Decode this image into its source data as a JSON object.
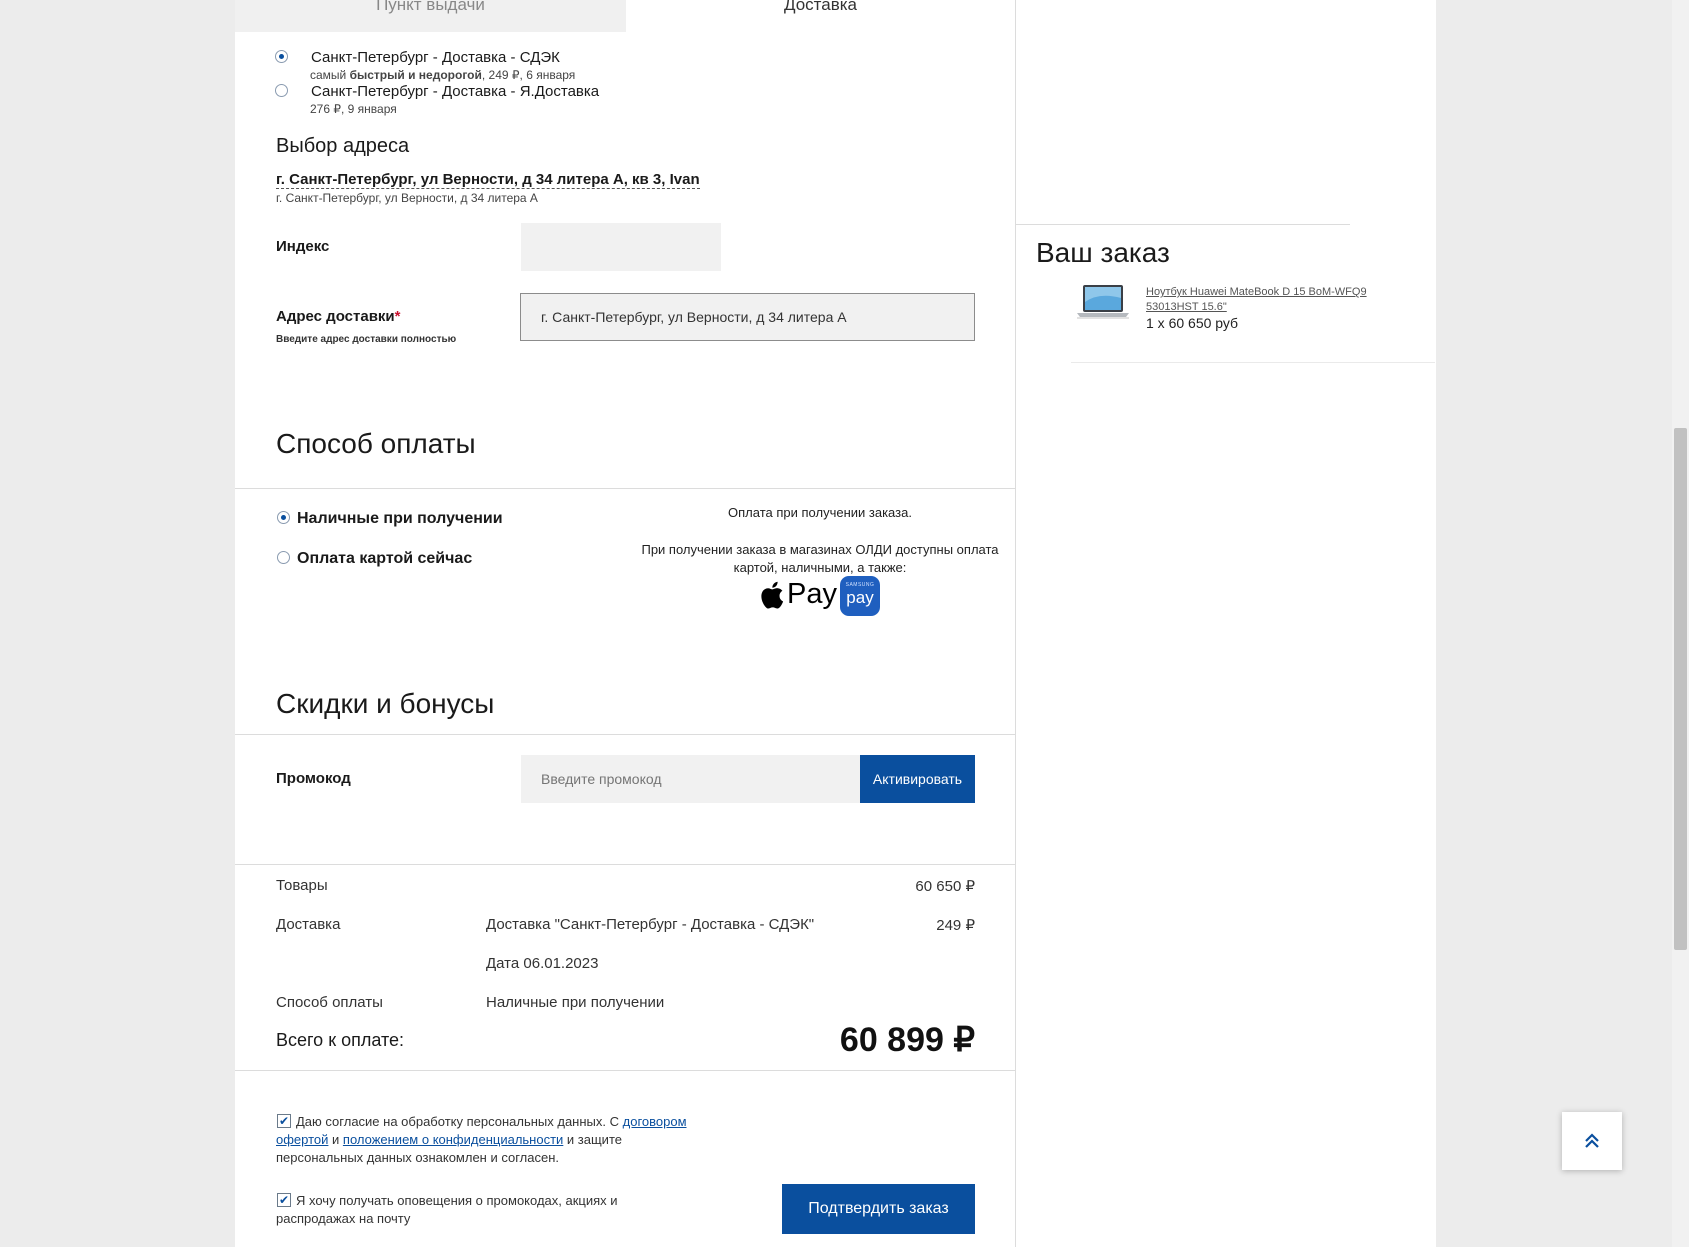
{
  "tabs": {
    "pickup": "Пункт выдачи",
    "delivery": "Доставка"
  },
  "delivery_options": [
    {
      "title": "Санкт-Петербург - Доставка - СДЭК",
      "sub_prefix": "самый ",
      "sub_bold": "быстрый и недорогой",
      "sub_suffix": ", 249 ₽, 6 января",
      "selected": true
    },
    {
      "title": "Санкт-Петербург - Доставка - Я.Доставка",
      "sub_prefix": "276 ₽, 9 января",
      "sub_bold": "",
      "sub_suffix": "",
      "selected": false
    }
  ],
  "address": {
    "heading": "Выбор адреса",
    "selected": "г. Санкт-Петербург, ул Верности, д 34 литера А, кв 3, Ivan",
    "selected_sub": "г. Санкт-Петербург, ул Верности, д 34 литера А",
    "index_label": "Индекс",
    "index_value": "",
    "delivery_label": "Адрес доставки",
    "required_mark": "*",
    "delivery_hint": "Введите адрес доставки полностью",
    "delivery_value": "г. Санкт-Петербург, ул Верности, д 34 литера А"
  },
  "payment": {
    "heading": "Способ оплаты",
    "options": [
      {
        "label": "Наличные при получении",
        "selected": true
      },
      {
        "label": "Оплата картой сейчас",
        "selected": false
      }
    ],
    "info_line1": "Оплата при получении заказа.",
    "info_line2": "При получении заказа в магазинах ОЛДИ доступны оплата картой, наличными, а также:",
    "apple_pay": "Pay",
    "samsung_pay_small": "SAMSUNG",
    "samsung_pay": "pay"
  },
  "discounts": {
    "heading": "Скидки и бонусы",
    "promo_label": "Промокод",
    "promo_placeholder": "Введите промокод",
    "activate": "Активировать"
  },
  "summary": {
    "goods_label": "Товары",
    "goods_value": "60 650 ₽",
    "delivery_label": "Доставка",
    "delivery_desc": "Доставка \"Санкт-Петербург - Доставка - СДЭК\"",
    "delivery_value": "249 ₽",
    "date": "Дата 06.01.2023",
    "payment_label": "Способ оплаты",
    "payment_value": "Наличные при получении",
    "total_label": "Всего к оплате:",
    "total_value": "60 899 ₽"
  },
  "consent": {
    "part1": "Даю согласие на обработку персональных данных. С ",
    "link1": "договором офертой",
    "part2": " и ",
    "link2": "положением о конфиденциальности",
    "part3": " и защите персональных данных ознакомлен и согласен.",
    "checked": true
  },
  "newsletter": {
    "text": "Я хочу получать оповещения о промокодах, акциях и распродажах на почту",
    "checked": true
  },
  "confirm_button": "Подтвердить заказ",
  "order": {
    "heading": "Ваш заказ",
    "item_name": "Ноутбук Huawei MateBook D 15 BoM-WFQ9 53013HST 15.6\"",
    "item_qty": "1 x 60 650 руб"
  },
  "colors": {
    "accent": "#0a4f9e",
    "required": "#c8102e",
    "page_bg": "#ececec"
  }
}
